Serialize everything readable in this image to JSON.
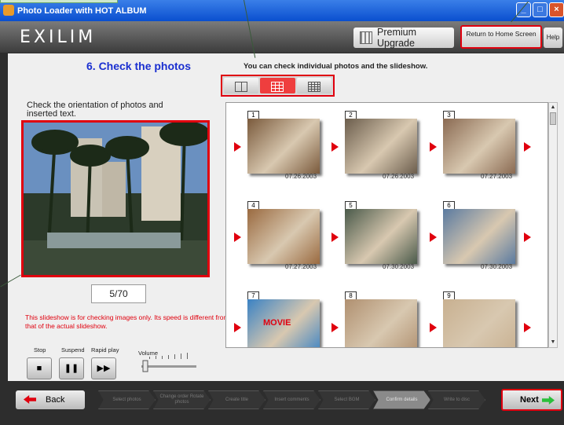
{
  "window": {
    "title": "Photo Loader with HOT ALBUM",
    "minimize": "_",
    "maximize": "□",
    "close": "×"
  },
  "header": {
    "logo": "EXILIM",
    "premium_upgrade": "Premium Upgrade",
    "return_home": "Return to Home Screen",
    "help": "Help"
  },
  "main": {
    "step_title": "6. Check the photos",
    "description": "You can check individual photos and the slideshow.",
    "left_note": "Check the orientation of photos and inserted text.",
    "counter": "5/70",
    "warning": "This slideshow is for checking images only. Its speed is different from that of the actual slideshow."
  },
  "controls": {
    "stop": "Stop",
    "suspend": "Suspend",
    "rapid_play": "Rapid play",
    "volume": "Volume",
    "stop_icon": "■",
    "suspend_icon": "❚❚",
    "rapid_icon": "▶▶"
  },
  "thumbnails": [
    {
      "num": "1",
      "date": "07.26.2003",
      "color": "#7a5a3c"
    },
    {
      "num": "2",
      "date": "07.26.2003",
      "color": "#6b5d4c"
    },
    {
      "num": "3",
      "date": "07.27.2003",
      "color": "#8a6a52"
    },
    {
      "num": "4",
      "date": "07.27.2003",
      "color": "#9a6a40"
    },
    {
      "num": "5",
      "date": "07.30.2003",
      "color": "#4a5a4a"
    },
    {
      "num": "6",
      "date": "07.30.2003",
      "color": "#5a7aa0"
    },
    {
      "num": "7",
      "date": "",
      "color": "#3a82c4",
      "label": "MOVIE"
    },
    {
      "num": "8",
      "date": "",
      "color": "#b09070"
    },
    {
      "num": "9",
      "date": "",
      "color": "#c8b090"
    }
  ],
  "footer": {
    "back": "Back",
    "next": "Next",
    "steps": [
      "Select photos",
      "Change order Rotate photos",
      "Create title",
      "Insert comments",
      "Select BGM",
      "Confirm details",
      "Write to disc"
    ],
    "active_step": 5
  }
}
